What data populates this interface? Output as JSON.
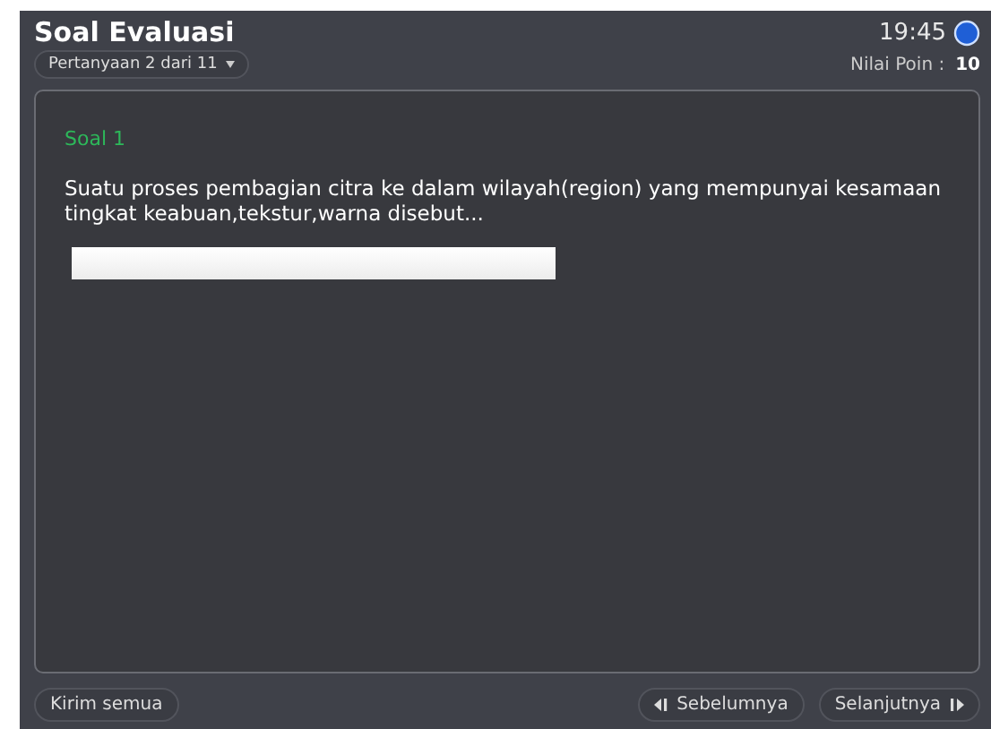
{
  "header": {
    "title": "Soal Evaluasi",
    "time": "19:45",
    "question_selector": "Pertanyaan 2 dari 11",
    "score_label": "Nilai Poin :",
    "score": "10"
  },
  "question": {
    "heading": "Soal 1",
    "text": "Suatu proses pembagian citra ke dalam wilayah(region) yang mempunyai kesamaan tingkat keabuan,tekstur,warna disebut..."
  },
  "footer": {
    "submit": "Kirim semua",
    "previous": "Sebelumnya",
    "next": "Selanjutnya"
  }
}
